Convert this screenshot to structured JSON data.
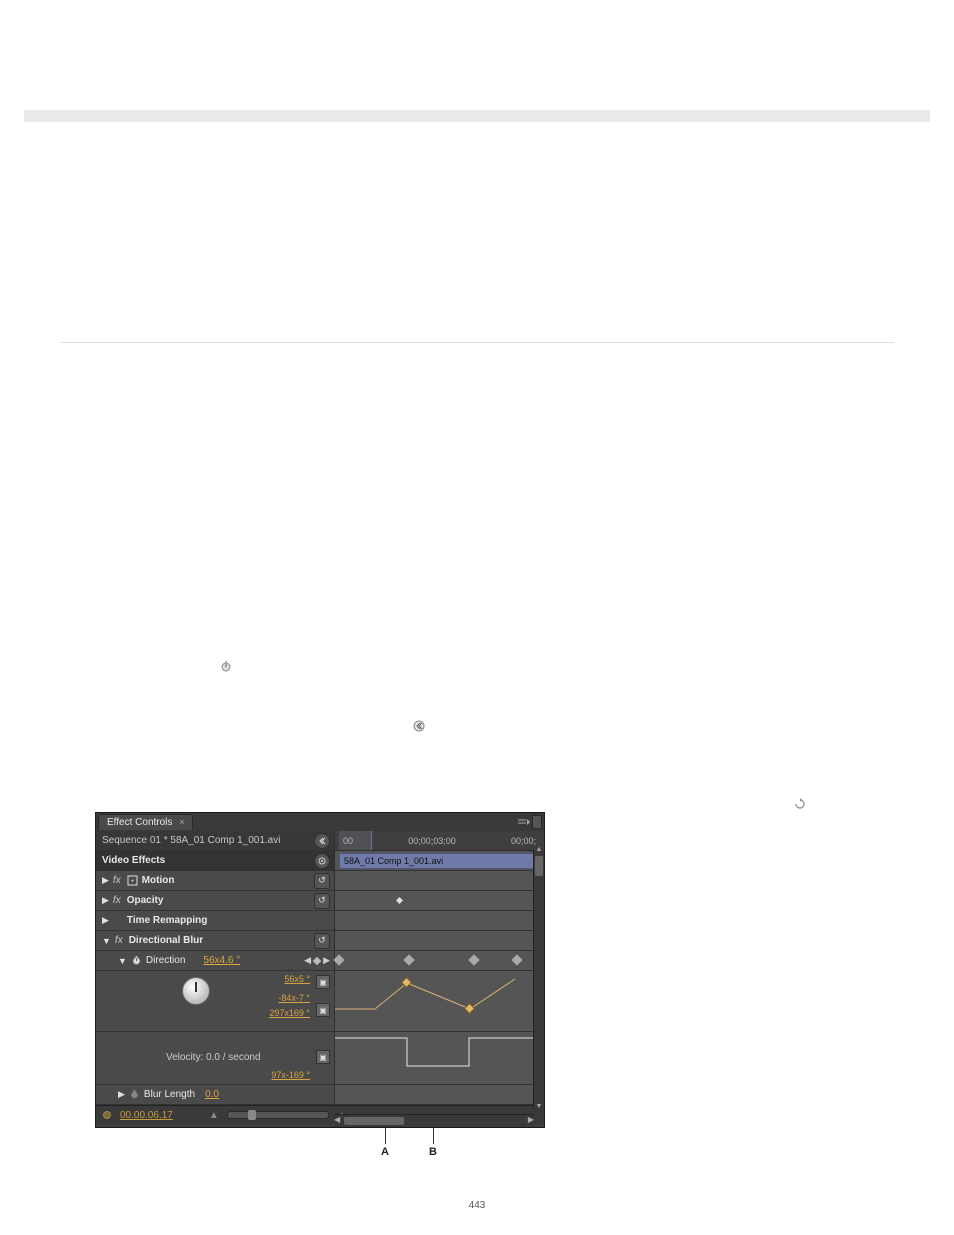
{
  "page_number": "443",
  "callouts": {
    "A": "A",
    "B": "B"
  },
  "panel": {
    "tab_title": "Effect Controls",
    "sequence_label": "Sequence 01 * 58A_01 Comp 1_001.avi",
    "timeline": {
      "tick1": "00",
      "tick2": "00;00;03;00",
      "tick3": "00;00;"
    },
    "clip_name": "58A_01 Comp 1_001.avi",
    "video_effects_header": "Video Effects",
    "effects": {
      "motion": "Motion",
      "opacity": "Opacity",
      "time_remapping": "Time Remapping",
      "directional_blur": "Directional Blur"
    },
    "direction": {
      "label": "Direction",
      "value": "56x4.6 °",
      "range_top": "56x5 °",
      "range_mid_neg": "-84x-7 °",
      "range_high": "297x169 °",
      "range_low": "97x-169 °"
    },
    "velocity_label": "Velocity: 0.0 / second",
    "blur_length": {
      "label": "Blur Length",
      "value": "0.0"
    },
    "current_time": "00.00.06.17"
  }
}
